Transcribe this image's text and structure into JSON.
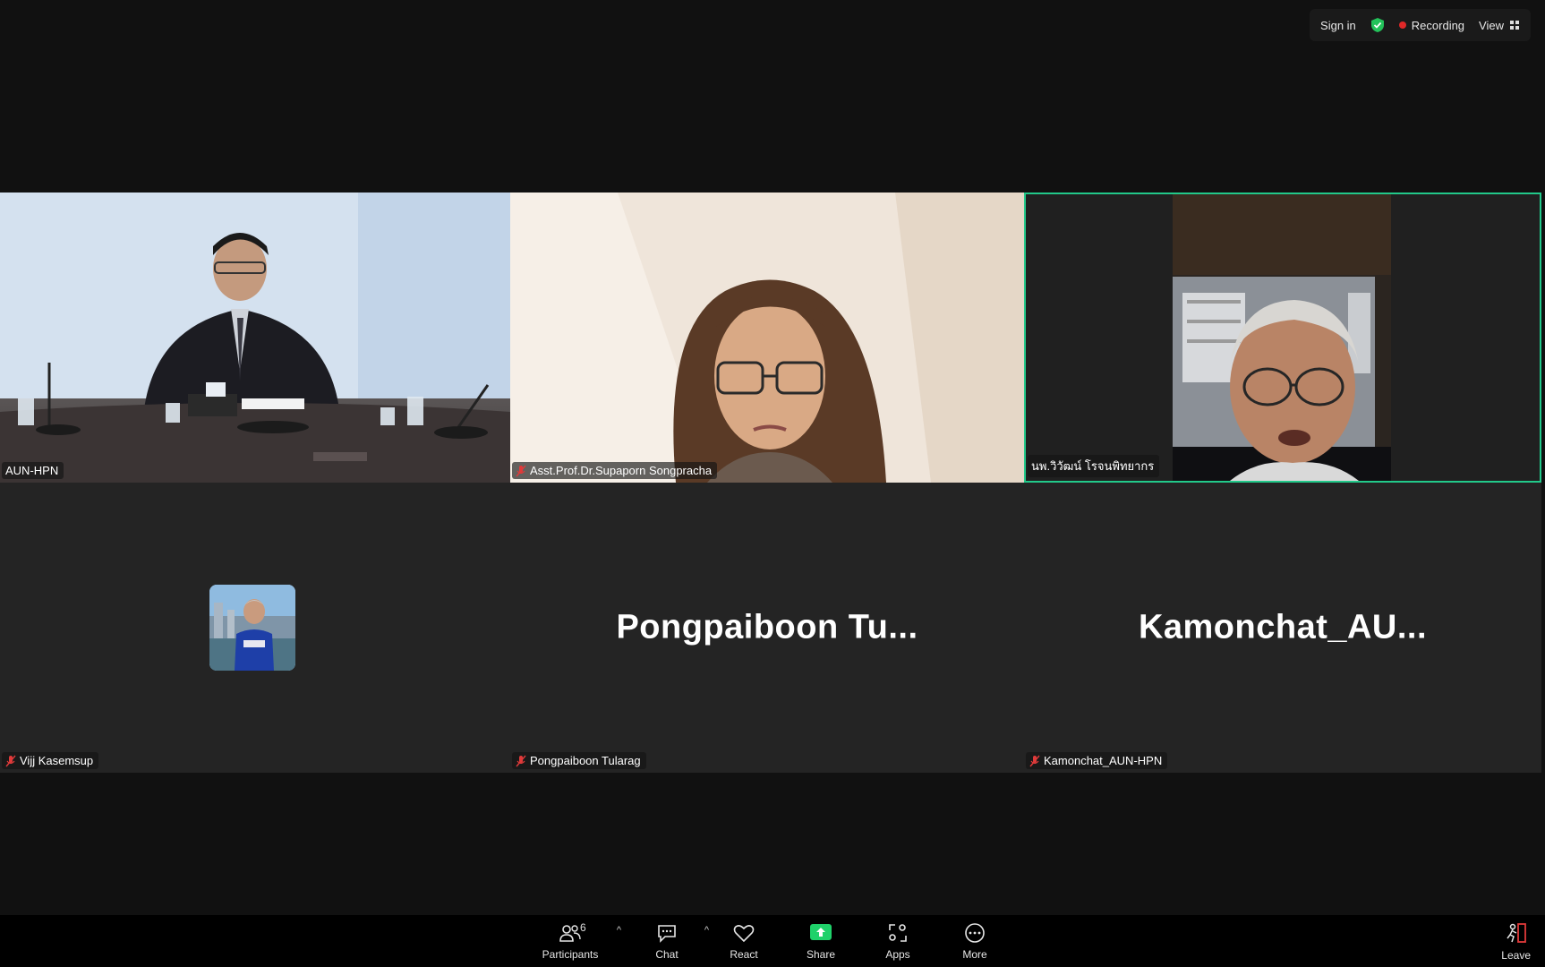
{
  "topbar": {
    "sign_in": "Sign in",
    "recording": "Recording",
    "view": "View"
  },
  "tiles": [
    {
      "name": "AUN-HPN",
      "muted": false
    },
    {
      "name": "Asst.Prof.Dr.Supaporn Songpracha",
      "muted": true
    },
    {
      "name": "นพ.วิวัฒน์ โรจนพิทยากร",
      "muted": false,
      "active": true
    },
    {
      "name": "Vijj Kasemsup",
      "muted": true
    },
    {
      "name": "Pongpaiboon Tularag",
      "muted": true,
      "display_name": "Pongpaiboon  Tu..."
    },
    {
      "name": "Kamonchat_AUN-HPN",
      "muted": true,
      "display_name": "Kamonchat_AU..."
    }
  ],
  "toolbar": {
    "participants": "Participants",
    "participants_count": "6",
    "chat": "Chat",
    "react": "React",
    "share": "Share",
    "apps": "Apps",
    "more": "More",
    "leave": "Leave"
  },
  "colors": {
    "active_border": "#22c98a",
    "share_green": "#1fd16a",
    "recording_red": "#e02828",
    "mute_red": "#e03a3a"
  }
}
